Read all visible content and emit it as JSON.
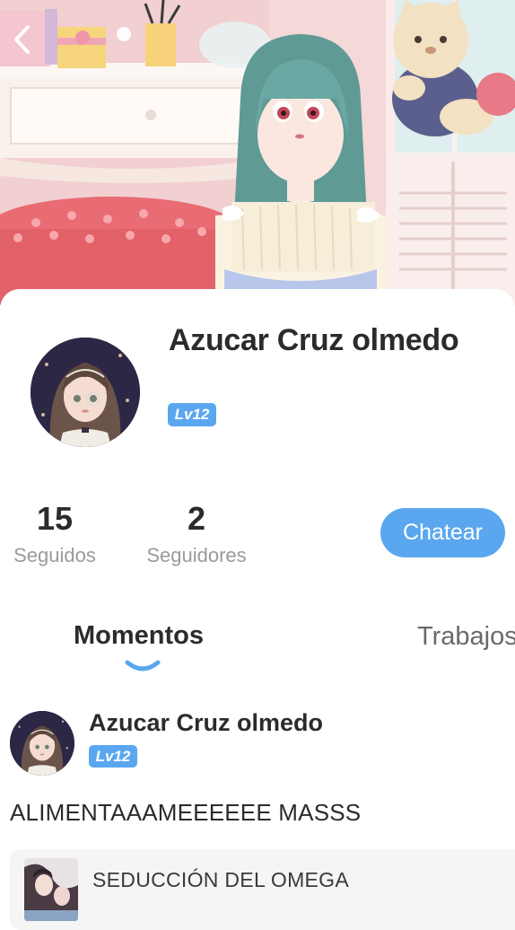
{
  "header": {
    "back_icon": "chevron-left-icon",
    "cover_description_icon": "profile-cover-image"
  },
  "profile": {
    "name": "Azucar Cruz olmedo",
    "level": "Lv12",
    "stats": [
      {
        "value": "15",
        "label": "Seguidos"
      },
      {
        "value": "2",
        "label": "Seguidores"
      }
    ],
    "chat_button": "Chatear"
  },
  "tabs": {
    "moments": "Momentos",
    "works": "Trabajos"
  },
  "post": {
    "author": "Azucar Cruz olmedo",
    "level": "Lv12",
    "text": "ALIMENTAAAMEEEEEE MASSS",
    "work_title": "SEDUCCIÓN DEL OMEGA"
  },
  "colors": {
    "accent": "#5aa7ef",
    "text": "#2b2b2b",
    "muted": "#9a9a9a",
    "card_bg": "#f5f5f5"
  }
}
